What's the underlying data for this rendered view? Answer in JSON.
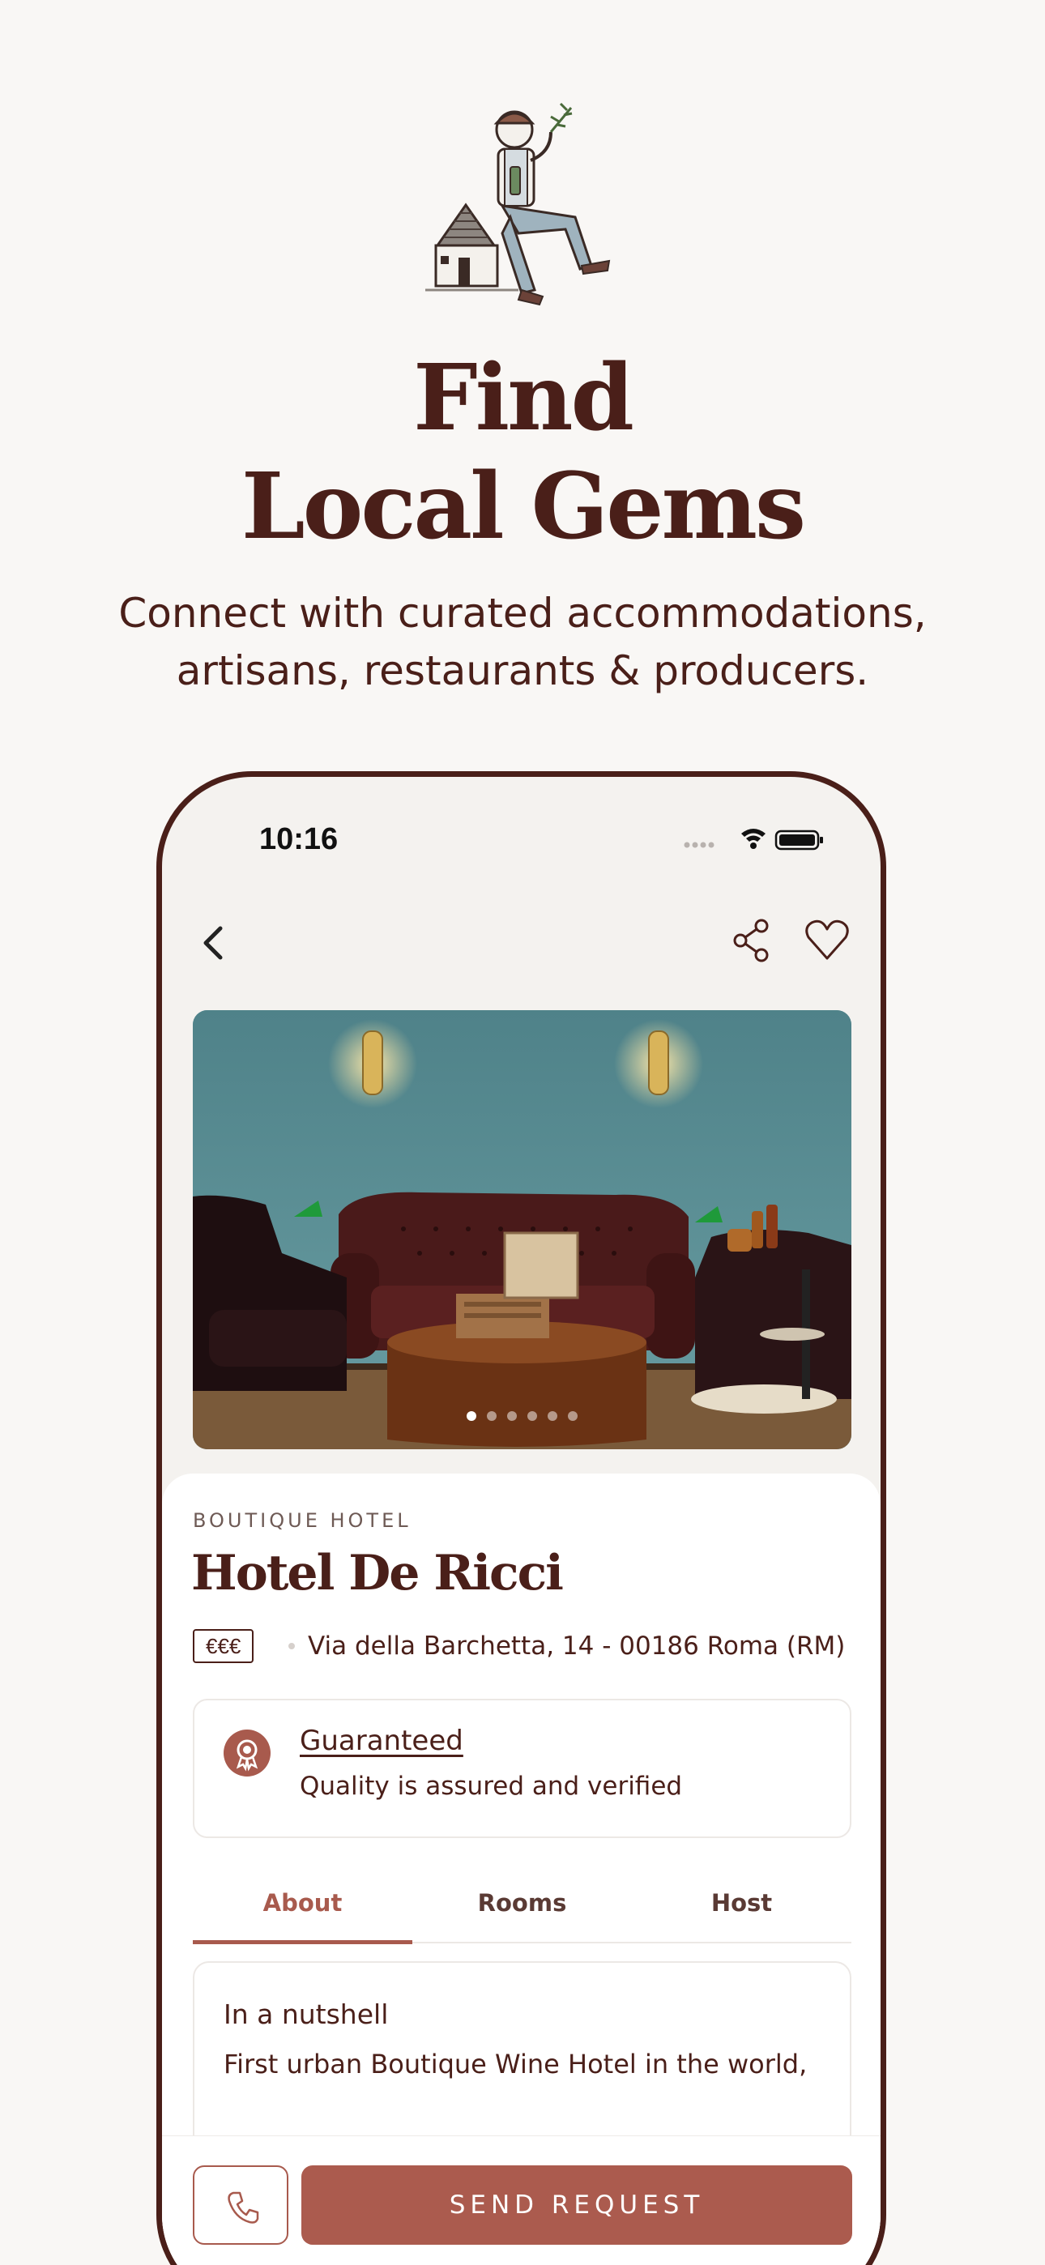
{
  "hero": {
    "title_line1": "Find",
    "title_line2": "Local Gems",
    "subtitle_line1": "Connect with curated accommodations,",
    "subtitle_line2": "artisans, restaurants & producers."
  },
  "status_bar": {
    "time": "10:16"
  },
  "listing": {
    "category": "BOUTIQUE HOTEL",
    "name": "Hotel De Ricci",
    "price_level": "€€€",
    "address": "Via della Barchetta, 14 - 00186 Roma (RM)",
    "photo_pages": 6,
    "photo_active_index": 0
  },
  "guarantee": {
    "title": "Guaranteed",
    "subtitle": "Quality is assured and verified"
  },
  "tabs": [
    {
      "label": "About",
      "active": true
    },
    {
      "label": "Rooms",
      "active": false
    },
    {
      "label": "Host",
      "active": false
    }
  ],
  "nutshell": {
    "title": "In a nutshell",
    "text": "First urban Boutique Wine Hotel in the world,"
  },
  "actions": {
    "send_label": "SEND REQUEST"
  },
  "colors": {
    "brand_dark": "#4a1f19",
    "accent": "#ab5b4e",
    "background": "#f9f7f5"
  },
  "icons": {
    "back": "chevron-left-icon",
    "share": "share-icon",
    "favorite": "heart-icon",
    "call": "phone-icon",
    "guarantee": "rosette-icon"
  }
}
